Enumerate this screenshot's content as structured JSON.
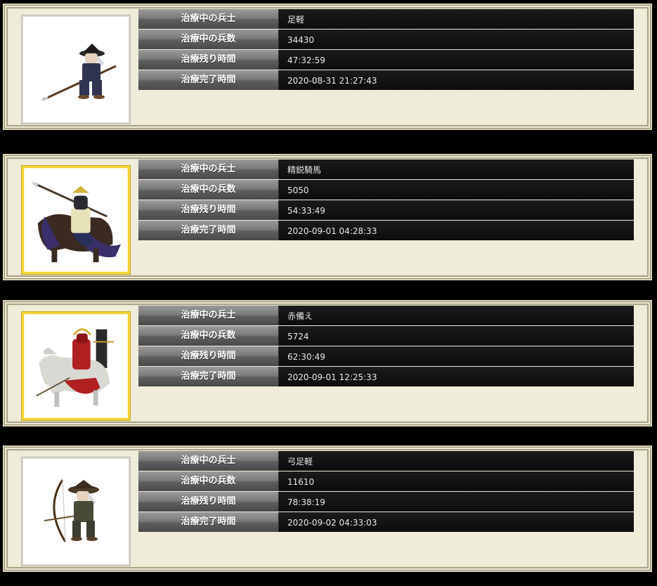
{
  "labels": {
    "unit": "治療中の兵士",
    "count": "治療中の兵数",
    "remaining": "治療残り時間",
    "completion": "治療完了時間"
  },
  "cards": [
    {
      "unit": "足軽",
      "count": "34430",
      "remaining": "47:32:59",
      "completion": "2020-08-31 21:27:43",
      "portrait_icon": "spearman-icon",
      "frame": "silver"
    },
    {
      "unit": "精鋭騎馬",
      "count": "5050",
      "remaining": "54:33:49",
      "completion": "2020-09-01 04:28:33",
      "portrait_icon": "cavalry-icon",
      "frame": "gold"
    },
    {
      "unit": "赤備え",
      "count": "5724",
      "remaining": "62:30:49",
      "completion": "2020-09-01 12:25:33",
      "portrait_icon": "red-armored-cavalry-icon",
      "frame": "gold"
    },
    {
      "unit": "弓足軽",
      "count": "11610",
      "remaining": "78:38:19",
      "completion": "2020-09-02 04:33:03",
      "portrait_icon": "archer-icon",
      "frame": "silver"
    }
  ]
}
